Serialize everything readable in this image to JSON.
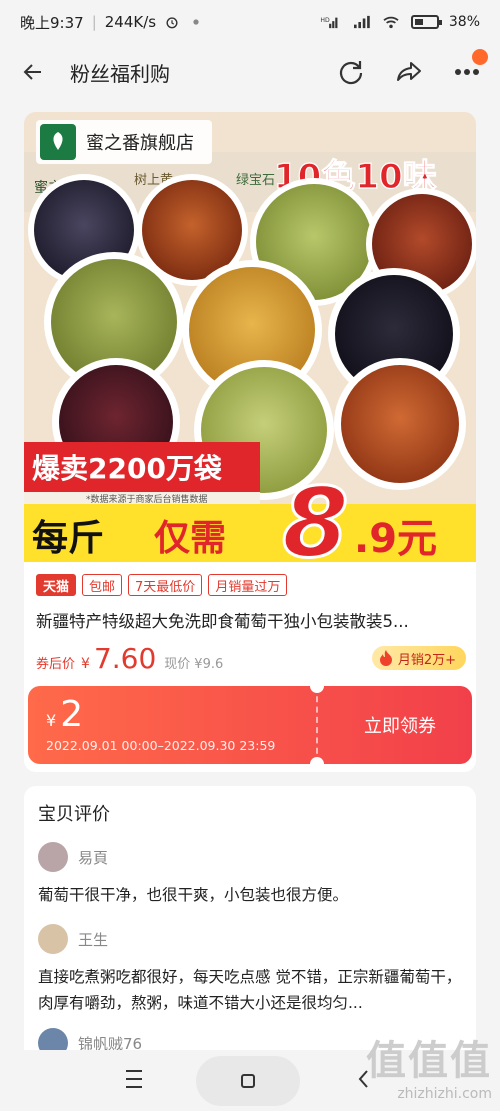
{
  "status_bar": {
    "time": "晚上9:37",
    "network_speed": "244K/s",
    "battery": "38%"
  },
  "header": {
    "title": "粉丝福利购"
  },
  "product": {
    "store_name": "蜜之番旗舰店",
    "image_texts": {
      "brand": "蜜之番",
      "headline": "10色10味",
      "labels": [
        "树上黄",
        "绿宝石"
      ],
      "sold": "爆卖2200万袋",
      "note": "*数据来源于商家后台销售数据",
      "price_prefix": "每斤",
      "price_mid": "仅需",
      "price_big": "8",
      "price_tail": ".9元"
    },
    "tags": [
      "天猫",
      "包邮",
      "7天最低价",
      "月销量过万"
    ],
    "title": "新疆特产特级超大免洗即食葡萄干独小包装散装5...",
    "after_coupon_label": "券后价",
    "currency": "¥",
    "after_coupon_price": "7.60",
    "current_label": "现价",
    "current_price": "¥9.6",
    "monthly_sales": "月销2万+"
  },
  "coupon": {
    "currency": "¥",
    "amount": "2",
    "validity": "2022.09.01 00:00–2022.09.30 23:59",
    "cta": "立即领券"
  },
  "reviews": {
    "title": "宝贝评价",
    "items": [
      {
        "user": "易頁",
        "text": "葡萄干很干净，也很干爽，小包装也很方便。"
      },
      {
        "user": "王生",
        "text": "直接吃煮粥吃都很好，每天吃点感 觉不错，正宗新疆葡萄干，肉厚有嚼劲，熬粥，味道不错大小还是很均匀..."
      },
      {
        "user": "锦帆贼76",
        "text": ""
      }
    ]
  },
  "watermark": {
    "logo": "值值值",
    "site": "zhizhizhi.com"
  },
  "colors": {
    "accent_red": "#e23a2e",
    "coupon_start": "#ff6a4a",
    "coupon_end": "#f2404a"
  }
}
